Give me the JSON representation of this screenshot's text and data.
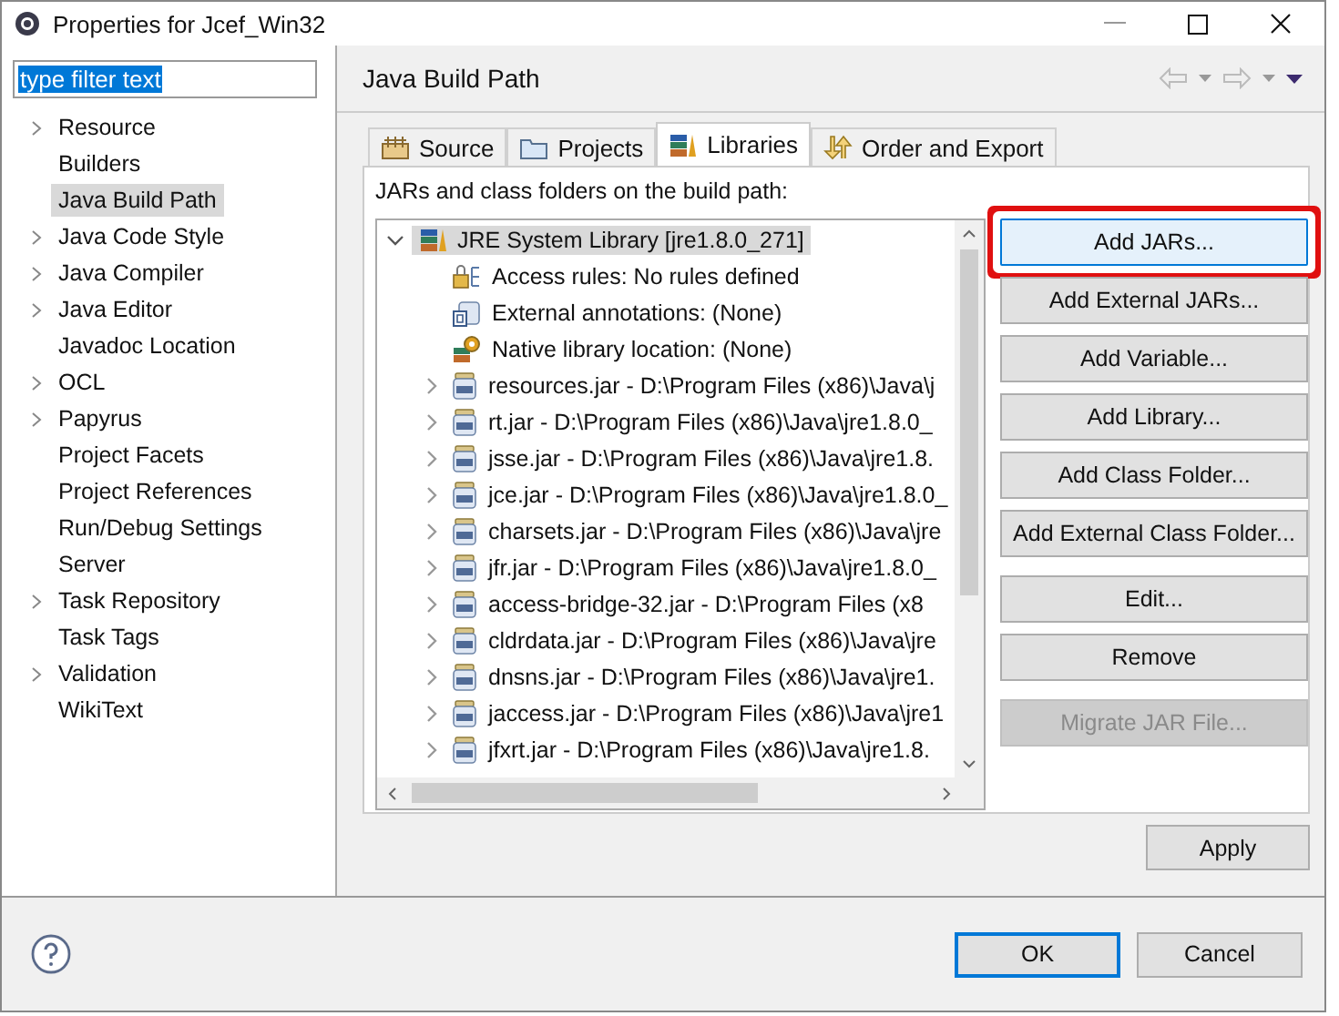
{
  "window": {
    "title": "Properties for Jcef_Win32"
  },
  "filter": {
    "value": "type filter text",
    "text_selected": true
  },
  "sidebar": {
    "items": [
      {
        "label": "Resource",
        "expandable": true,
        "selected": false
      },
      {
        "label": "Builders",
        "expandable": false,
        "selected": false
      },
      {
        "label": "Java Build Path",
        "expandable": false,
        "selected": true
      },
      {
        "label": "Java Code Style",
        "expandable": true,
        "selected": false
      },
      {
        "label": "Java Compiler",
        "expandable": true,
        "selected": false
      },
      {
        "label": "Java Editor",
        "expandable": true,
        "selected": false
      },
      {
        "label": "Javadoc Location",
        "expandable": false,
        "selected": false
      },
      {
        "label": "OCL",
        "expandable": true,
        "selected": false
      },
      {
        "label": "Papyrus",
        "expandable": true,
        "selected": false
      },
      {
        "label": "Project Facets",
        "expandable": false,
        "selected": false
      },
      {
        "label": "Project References",
        "expandable": false,
        "selected": false
      },
      {
        "label": "Run/Debug Settings",
        "expandable": false,
        "selected": false
      },
      {
        "label": "Server",
        "expandable": false,
        "selected": false
      },
      {
        "label": "Task Repository",
        "expandable": true,
        "selected": false
      },
      {
        "label": "Task Tags",
        "expandable": false,
        "selected": false
      },
      {
        "label": "Validation",
        "expandable": true,
        "selected": false
      },
      {
        "label": "WikiText",
        "expandable": false,
        "selected": false
      }
    ]
  },
  "page": {
    "title": "Java Build Path"
  },
  "tabs": [
    {
      "label": "Source",
      "kind": "source",
      "selected": false
    },
    {
      "label": "Projects",
      "kind": "projects",
      "selected": false
    },
    {
      "label": "Libraries",
      "kind": "libraries",
      "selected": true
    },
    {
      "label": "Order and Export",
      "kind": "order",
      "selected": false
    }
  ],
  "tree_caption": "JARs and class folders on the build path:",
  "tree": [
    {
      "label": "JRE System Library [jre1.8.0_271]",
      "kind": "library",
      "expanded": true,
      "selected": true,
      "children": [
        {
          "label": "Access rules: No rules defined",
          "kind": "access"
        },
        {
          "label": "External annotations: (None)",
          "kind": "annotations"
        },
        {
          "label": "Native library location: (None)",
          "kind": "native"
        },
        {
          "label": "resources.jar - D:\\Program Files (x86)\\Java\\j",
          "kind": "jar",
          "expanded": false
        },
        {
          "label": "rt.jar - D:\\Program Files (x86)\\Java\\jre1.8.0_",
          "kind": "jar",
          "expanded": false
        },
        {
          "label": "jsse.jar - D:\\Program Files (x86)\\Java\\jre1.8.",
          "kind": "jar",
          "expanded": false
        },
        {
          "label": "jce.jar - D:\\Program Files (x86)\\Java\\jre1.8.0_",
          "kind": "jar",
          "expanded": false
        },
        {
          "label": "charsets.jar - D:\\Program Files (x86)\\Java\\jre",
          "kind": "jar",
          "expanded": false
        },
        {
          "label": "jfr.jar - D:\\Program Files (x86)\\Java\\jre1.8.0_",
          "kind": "jar",
          "expanded": false
        },
        {
          "label": "access-bridge-32.jar - D:\\Program Files (x8",
          "kind": "jar",
          "expanded": false
        },
        {
          "label": "cldrdata.jar - D:\\Program Files (x86)\\Java\\jre",
          "kind": "jar",
          "expanded": false
        },
        {
          "label": "dnsns.jar - D:\\Program Files (x86)\\Java\\jre1.",
          "kind": "jar",
          "expanded": false
        },
        {
          "label": "jaccess.jar - D:\\Program Files (x86)\\Java\\jre1",
          "kind": "jar",
          "expanded": false
        },
        {
          "label": "jfxrt.jar - D:\\Program Files (x86)\\Java\\jre1.8.",
          "kind": "jar",
          "expanded": false
        }
      ]
    }
  ],
  "button_groups": [
    [
      {
        "label": "Add JARs...",
        "highlighted": true,
        "disabled": false
      },
      {
        "label": "Add External JARs...",
        "highlighted": false,
        "disabled": false
      },
      {
        "label": "Add Variable...",
        "highlighted": false,
        "disabled": false
      },
      {
        "label": "Add Library...",
        "highlighted": false,
        "disabled": false
      },
      {
        "label": "Add Class Folder...",
        "highlighted": false,
        "disabled": false
      },
      {
        "label": "Add External Class Folder...",
        "highlighted": false,
        "disabled": false
      }
    ],
    [
      {
        "label": "Edit...",
        "highlighted": false,
        "disabled": false
      },
      {
        "label": "Remove",
        "highlighted": false,
        "disabled": false
      }
    ],
    [
      {
        "label": "Migrate JAR File...",
        "highlighted": false,
        "disabled": true
      }
    ]
  ],
  "apply_button": "Apply",
  "footer_buttons": [
    {
      "label": "OK",
      "default": true
    },
    {
      "label": "Cancel",
      "default": false
    }
  ]
}
